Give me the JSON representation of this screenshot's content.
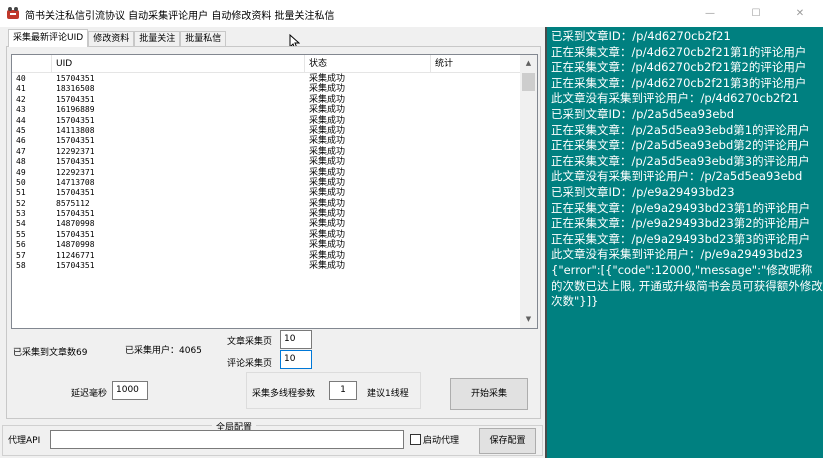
{
  "window": {
    "title": "简书关注私信引流协议 自动采集评论用户 自动修改资料 批量关注私信",
    "minimize_glyph": "—",
    "maximize_glyph": "☐",
    "close_glyph": "✕"
  },
  "tabs": [
    {
      "label": "采集最新评论UID",
      "active": true
    },
    {
      "label": "修改资料"
    },
    {
      "label": "批量关注"
    },
    {
      "label": "批量私信"
    }
  ],
  "table": {
    "columns": [
      "",
      "UID",
      "状态",
      "统计"
    ],
    "rows": [
      [
        "40",
        "15704351",
        "采集成功"
      ],
      [
        "41",
        "18316508",
        "采集成功"
      ],
      [
        "42",
        "15704351",
        "采集成功"
      ],
      [
        "43",
        "16196889",
        "采集成功"
      ],
      [
        "44",
        "15704351",
        "采集成功"
      ],
      [
        "45",
        "14113808",
        "采集成功"
      ],
      [
        "46",
        "15704351",
        "采集成功"
      ],
      [
        "47",
        "12292371",
        "采集成功"
      ],
      [
        "48",
        "15704351",
        "采集成功"
      ],
      [
        "49",
        "12292371",
        "采集成功"
      ],
      [
        "50",
        "14713708",
        "采集成功"
      ],
      [
        "51",
        "15704351",
        "采集成功"
      ],
      [
        "52",
        "8575112",
        "采集成功"
      ],
      [
        "53",
        "15704351",
        "采集成功"
      ],
      [
        "54",
        "14870998",
        "采集成功"
      ],
      [
        "55",
        "15704351",
        "采集成功"
      ],
      [
        "56",
        "14870998",
        "采集成功"
      ],
      [
        "57",
        "11246771",
        "采集成功"
      ],
      [
        "58",
        "15704351",
        "采集成功"
      ]
    ]
  },
  "stats": {
    "articles_collected": "已采集到文章数69",
    "users_collected": "已采集用户：4065"
  },
  "fields": {
    "article_pages_label": "文章采集页",
    "article_pages_value": "10",
    "comment_pages_label": "评论采集页",
    "comment_pages_value": "10",
    "delay_label": "延迟毫秒",
    "delay_value": "1000",
    "threads_label": "采集多线程参数",
    "threads_value": "1",
    "threads_hint": "建议1线程",
    "start_button": "开始采集"
  },
  "global_config": {
    "title": "全局配置",
    "proxy_label": "代理API",
    "proxy_value": "",
    "enable_proxy_label": "启动代理",
    "save_button": "保存配置"
  },
  "log_lines": [
    "已采到文章ID：/p/4d6270cb2f21",
    "正在采集文章：/p/4d6270cb2f21第1的评论用户",
    "正在采集文章：/p/4d6270cb2f21第2的评论用户",
    "正在采集文章：/p/4d6270cb2f21第3的评论用户",
    "此文章没有采集到评论用户：/p/4d6270cb2f21",
    "已采到文章ID：/p/2a5d5ea93ebd",
    "正在采集文章：/p/2a5d5ea93ebd第1的评论用户",
    "正在采集文章：/p/2a5d5ea93ebd第2的评论用户",
    "正在采集文章：/p/2a5d5ea93ebd第3的评论用户",
    "此文章没有采集到评论用户：/p/2a5d5ea93ebd",
    "已采到文章ID：/p/e9a29493bd23",
    "正在采集文章：/p/e9a29493bd23第1的评论用户",
    "正在采集文章：/p/e9a29493bd23第2的评论用户",
    "正在采集文章：/p/e9a29493bd23第3的评论用户",
    "此文章没有采集到评论用户：/p/e9a29493bd23",
    "{\"error\":[{\"code\":12000,\"message\":\"修改昵称的次数已达上限, 开通或升级简书会员可获得额外修改次数\"}]}"
  ]
}
